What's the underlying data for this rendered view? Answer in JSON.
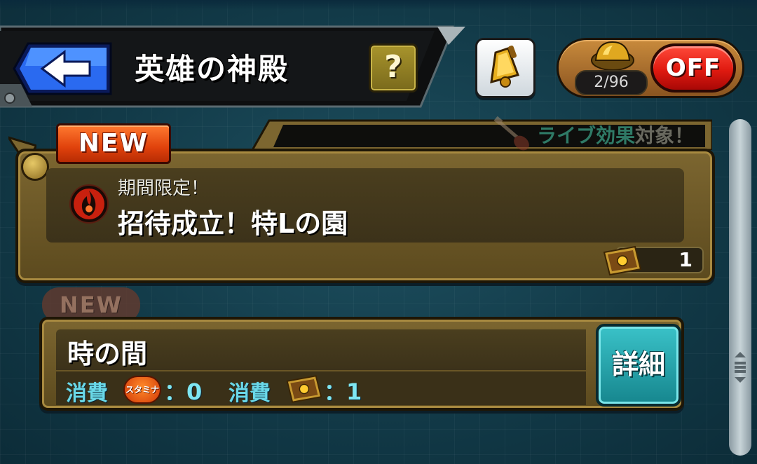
{
  "header": {
    "title": "英雄の神殿",
    "help_label": "?",
    "multi_counter": "2/96",
    "toggle_label": "OFF"
  },
  "quests": [
    {
      "badge": "NEW",
      "live_effect_prefix": "ライブ効果",
      "live_effect_suffix": "対象！",
      "subtitle": "期間限定！",
      "title": "招待成立！特Lの園",
      "ticket_count": "1"
    },
    {
      "badge": "NEW",
      "title": "時の間",
      "cost1_label": "消費",
      "stamina_label": "スタミナ",
      "cost1_value": "：0",
      "cost2_label": "消費",
      "cost2_value": "：1",
      "detail_label": "詳細"
    }
  ],
  "colors": {
    "background": "#143e4c",
    "card_gold": "#7c6630",
    "accent_cyan": "#6ad8e8",
    "toggle_red": "#e01a10",
    "new_orange": "#e0420c"
  },
  "icons": [
    "back-arrow-icon",
    "help-icon",
    "bell-icon",
    "helmet-icon",
    "guitar-icon",
    "fire-icon",
    "ticket-icon",
    "stamina-icon",
    "scroll-grip-icon"
  ]
}
